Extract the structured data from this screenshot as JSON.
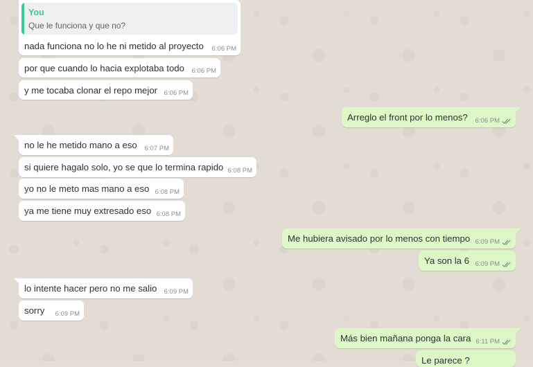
{
  "chat": {
    "reply": {
      "author": "You",
      "quoted_text": "Que le funciona  y que no?",
      "text": "nada funciona no lo he ni metido al proyecto",
      "time": "6:06 PM"
    },
    "messages": [
      {
        "id": "m1",
        "dir": "in",
        "text": "por que cuando lo hacia explotaba todo",
        "time": "6:06 PM"
      },
      {
        "id": "m2",
        "dir": "in",
        "text": "y me tocaba clonar el repo mejor",
        "time": "6:06 PM"
      },
      {
        "id": "m3",
        "dir": "out",
        "text": "Arreglo el front por lo menos?",
        "time": "6:06 PM",
        "status": "read"
      },
      {
        "id": "m4",
        "dir": "in",
        "text": "no le he metido mano a eso",
        "time": "6:07 PM"
      },
      {
        "id": "m5",
        "dir": "in",
        "text": "si quiere hagalo solo, yo se que lo termina rapido",
        "time": "6:08 PM"
      },
      {
        "id": "m6",
        "dir": "in",
        "text": "yo no le meto mas mano a eso",
        "time": "6:08 PM"
      },
      {
        "id": "m7",
        "dir": "in",
        "text": "ya me tiene muy extresado eso",
        "time": "6:08 PM"
      },
      {
        "id": "m8",
        "dir": "out",
        "text": "Me hubiera avisado por lo menos con tiempo",
        "time": "6:09 PM",
        "status": "read"
      },
      {
        "id": "m9",
        "dir": "out",
        "text": "Ya son la 6",
        "time": "6:09 PM",
        "status": "read"
      },
      {
        "id": "m10",
        "dir": "in",
        "text": "lo intente hacer pero no me salio",
        "time": "6:09 PM"
      },
      {
        "id": "m11",
        "dir": "in",
        "text": "sorry",
        "time": "6:09 PM"
      },
      {
        "id": "m12",
        "dir": "out",
        "text": "Más bien mañana ponga la cara",
        "time": "6:11 PM",
        "status": "read"
      },
      {
        "id": "m13",
        "dir": "out",
        "text": "Le parece ?",
        "time": "",
        "status": ""
      }
    ]
  },
  "colors": {
    "incoming_bubble": "#ffffff",
    "outgoing_bubble": "#dcf8c6",
    "quote_accent": "#35cd96",
    "read_ticks": "#8c8c8c",
    "wallpaper": "#e3dcd4"
  },
  "icons": {
    "read_receipt": "double-check-icon"
  }
}
